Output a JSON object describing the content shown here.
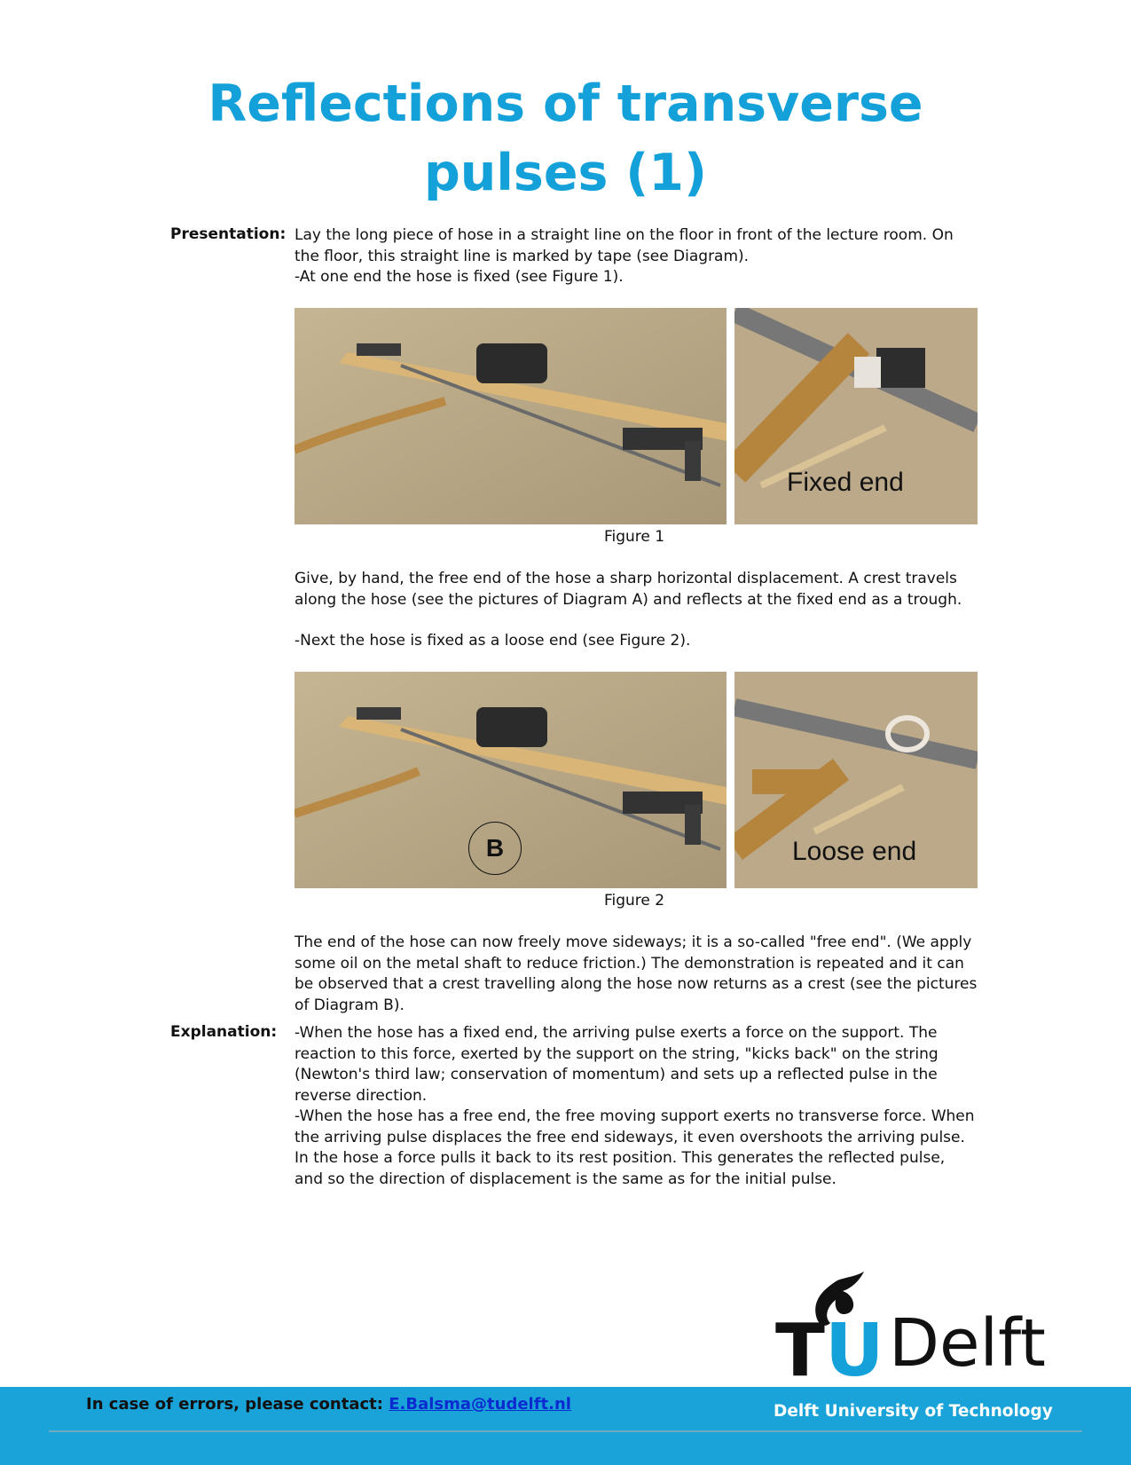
{
  "title_line1": "Reflections of transverse",
  "title_line2": "pulses (1)",
  "presentation": {
    "label": "Presentation:",
    "p1": "Lay the long piece of hose in a straight line on the floor in front of the lecture room. On the floor, this straight line is marked by tape (see Diagram).",
    "p2": "-At one end the hose is fixed (see Figure 1).",
    "figure1": {
      "photo_caption": "Fixed end",
      "caption": "Figure 1"
    },
    "p3": "Give, by hand, the free end of the hose a sharp horizontal displacement. A crest travels along the hose (see the pictures of Diagram A) and reflects at the fixed end as a trough.",
    "p4": "-Next the hose is fixed as a loose end (see Figure 2).",
    "figure2": {
      "marker": "B",
      "photo_caption": "Loose end",
      "caption": "Figure 2"
    },
    "p5": "The end of the hose can now freely move sideways; it is a so-called \"free end\". (We apply some oil on the metal shaft to reduce friction.) The demonstration is repeated and it can be observed that a crest travelling along the hose now returns as a crest (see the pictures of Diagram B)."
  },
  "explanation": {
    "label": "Explanation:",
    "p1": "-When the hose has a fixed end, the arriving pulse exerts a force on the support. The reaction to this force, exerted by the support on the string, \"kicks back\" on the string (Newton's third law; conservation of momentum) and sets up a reflected pulse in the reverse direction.",
    "p2": "-When the hose has a free end, the free moving support exerts no transverse force. When the arriving pulse displaces the free end sideways, it even overshoots the arriving pulse. In the hose a force pulls it back to its rest position. This generates the reflected pulse, and so the direction of displacement is the same as for the initial pulse."
  },
  "logo": {
    "tu": "TU",
    "word": "Delft"
  },
  "footer": {
    "contact_label": "In case of errors, please contact:",
    "email": "E.Balsma@tudelft.nl",
    "university": "Delft University of Technology"
  },
  "colors": {
    "title": "#14a0d8",
    "footer_band": "#1aa3d8",
    "link": "#0b2bd0",
    "photo_floor": "#b9a98a"
  }
}
